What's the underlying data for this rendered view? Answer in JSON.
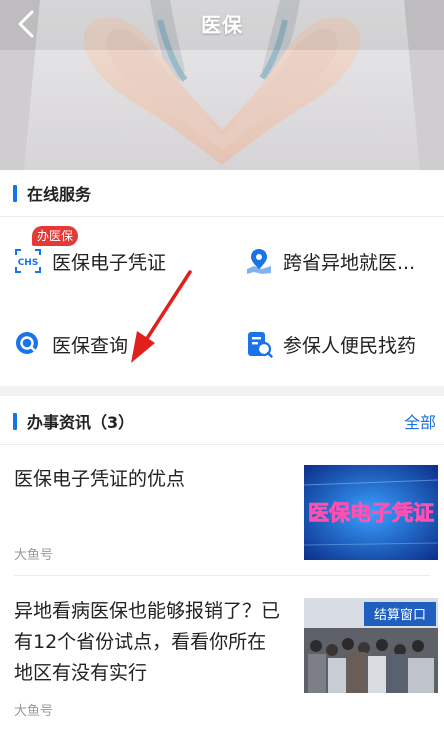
{
  "header": {
    "title": "医保",
    "back_icon": "chevron-left-icon"
  },
  "online_services": {
    "title": "在线服务",
    "items": [
      {
        "label": "医保电子凭证",
        "icon": "chs-card-icon",
        "badge": "办医保"
      },
      {
        "label": "跨省异地就医...",
        "icon": "map-pin-icon"
      },
      {
        "label": "医保查询",
        "icon": "search-icon"
      },
      {
        "label": "参保人便民找药",
        "icon": "medicine-search-icon"
      }
    ]
  },
  "news": {
    "title": "办事资讯（3）",
    "more_label": "全部",
    "items": [
      {
        "title": "医保电子凭证的优点",
        "source": "大鱼号",
        "thumb_text": "医保电子凭证"
      },
      {
        "title": "异地看病医保也能够报销了？已有12个省份试点，看看你所在地区有没有实行",
        "source": "大鱼号",
        "thumb_text": "结算窗口"
      }
    ]
  },
  "colors": {
    "accent": "#1a73e8",
    "badge": "#e53935",
    "arrow": "#e0201a"
  }
}
